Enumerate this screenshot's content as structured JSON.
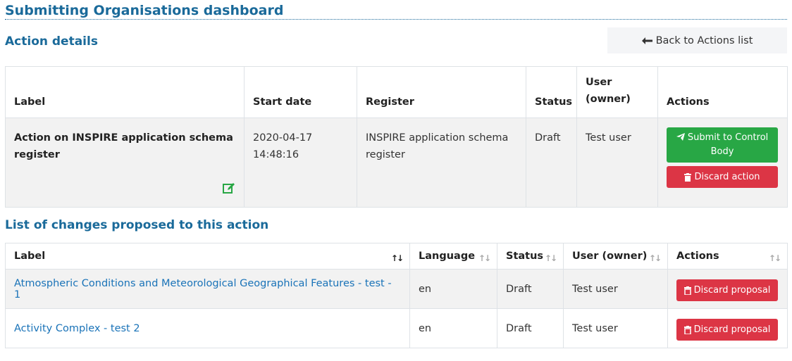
{
  "page": {
    "title": "Submitting Organisations dashboard"
  },
  "action_details": {
    "section_title": "Action details",
    "back_label": "Back to Actions list",
    "headers": {
      "label": "Label",
      "start_date": "Start date",
      "register": "Register",
      "status": "Status",
      "user": "User (owner)",
      "actions": "Actions"
    },
    "row": {
      "label": "Action on INSPIRE application schema register",
      "start_date": "2020-04-17 14:48:16",
      "register": "INSPIRE application schema register",
      "status": "Draft",
      "user": "Test user",
      "submit_label": "Submit to Control Body",
      "discard_label": "Discard action"
    }
  },
  "changes": {
    "section_title": "List of changes proposed to this action",
    "headers": {
      "label": "Label",
      "language": "Language",
      "status": "Status",
      "user": "User (owner)",
      "actions": "Actions"
    },
    "rows": [
      {
        "label": "Atmospheric Conditions and Meteorological Geographical Features - test - 1",
        "language": "en",
        "status": "Draft",
        "user": "Test user",
        "discard_label": "Discard proposal"
      },
      {
        "label": "Activity Complex - test 2",
        "language": "en",
        "status": "Draft",
        "user": "Test user",
        "discard_label": "Discard proposal"
      }
    ]
  },
  "colors": {
    "heading": "#1a6a9a",
    "link": "#1a73b8",
    "success": "#28a745",
    "danger": "#dc3545"
  },
  "icons": {
    "back": "arrow-left-icon",
    "edit": "edit-icon",
    "submit": "paper-plane-icon",
    "discard": "trash-icon",
    "sort": "sort-icon"
  }
}
